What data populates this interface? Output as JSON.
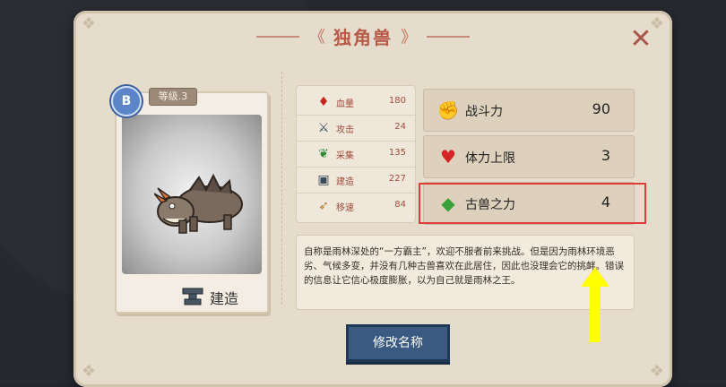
{
  "title": "独角兽",
  "close_glyph": "✕",
  "card": {
    "grade": "B",
    "level": "等级.3",
    "footer_label": "建造"
  },
  "stats_left": [
    {
      "icon": "blood-drop-icon",
      "glyph": "♦",
      "color": "#c0261f",
      "label": "血量",
      "value": "180"
    },
    {
      "icon": "crossed-swords-icon",
      "glyph": "⚔",
      "color": "#3c4a55",
      "label": "攻击",
      "value": "24"
    },
    {
      "icon": "leaf-icon",
      "glyph": "❦",
      "color": "#2d8a3a",
      "label": "采集",
      "value": "135"
    },
    {
      "icon": "anvil-icon",
      "glyph": "▣",
      "color": "#3b4a58",
      "label": "建造",
      "value": "227"
    },
    {
      "icon": "boot-icon",
      "glyph": "➶",
      "color": "#b07a36",
      "label": "移速",
      "value": "84"
    }
  ],
  "stats_right": [
    {
      "icon": "fist-icon",
      "glyph": "✊",
      "color": "#4b5866",
      "label": "战斗力",
      "value": "90"
    },
    {
      "icon": "heart-arrow-icon",
      "glyph": "♥",
      "color": "#d42424",
      "label": "体力上限",
      "value": "3"
    },
    {
      "icon": "green-gem-icon",
      "glyph": "◆",
      "color": "#3aa13a",
      "label": "古兽之力",
      "value": "4"
    }
  ],
  "description": "自称是雨林深处的“一方霸主”，欢迎不服者前来挑战。但是因为雨林环境恶劣、气候多变，并没有几种古兽喜欢在此居住，因此也没理会它的挑衅。错误的信息让它信心极度膨胀，以为自己就是雨林之王。",
  "rename_button": "修改名称",
  "colors": {
    "panel": "#e6dccb",
    "title": "#b85a48",
    "highlight": "#e23b3b",
    "arrow": "#ffff00",
    "button": "#3a5a82"
  }
}
